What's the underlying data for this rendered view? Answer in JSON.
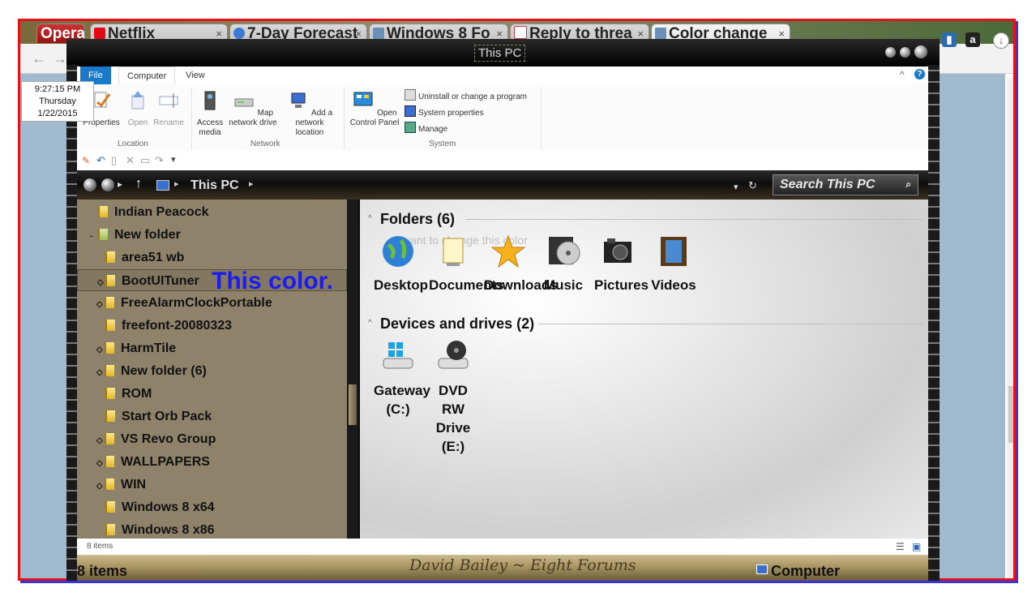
{
  "browser": {
    "tabs": [
      {
        "label": "Opera"
      },
      {
        "label": "Netflix"
      },
      {
        "label": "7-Day Forecast"
      },
      {
        "label": "Windows 8 Fo"
      },
      {
        "label": "Reply to threa"
      },
      {
        "label": "Color change"
      }
    ],
    "close_glyph": "×"
  },
  "clock": {
    "time": "9:27:15 PM",
    "day": "Thursday",
    "date": "1/22/2015"
  },
  "explorer": {
    "title": "This PC",
    "ribbon_tabs": {
      "file": "File",
      "computer": "Computer",
      "view": "View"
    },
    "ribbon": {
      "properties": "Properties",
      "open": "Open",
      "rename": "Rename",
      "access_media": "Access media",
      "map_network_drive": "Map network drive",
      "add_network_location": "Add a network location",
      "open_control_panel": "Open Control Panel",
      "uninstall": "Uninstall or change a program",
      "system_properties": "System properties",
      "manage": "Manage",
      "group_location": "Location",
      "group_network": "Network",
      "group_system": "System"
    },
    "address": {
      "path": "This PC"
    },
    "search_placeholder": "Search This PC",
    "nav_items": [
      {
        "label": "Indian Peacock",
        "expander": ""
      },
      {
        "label": "New folder",
        "expander": "-"
      },
      {
        "label": "area51 wb",
        "expander": ""
      },
      {
        "label": "BootUITuner",
        "expander": "◇"
      },
      {
        "label": "FreeAlarmClockPortable",
        "expander": "◇"
      },
      {
        "label": "freefont-20080323",
        "expander": ""
      },
      {
        "label": "HarmTile",
        "expander": "◇"
      },
      {
        "label": "New folder (6)",
        "expander": "◇"
      },
      {
        "label": "ROM",
        "expander": ""
      },
      {
        "label": "Start Orb Pack",
        "expander": ""
      },
      {
        "label": "VS Revo Group",
        "expander": "◇"
      },
      {
        "label": "WALLPAPERS",
        "expander": "◇"
      },
      {
        "label": "WIN",
        "expander": "◇"
      },
      {
        "label": "Windows 8 x64",
        "expander": ""
      },
      {
        "label": "Windows 8 x86",
        "expander": ""
      }
    ],
    "annotation": "This color.",
    "ghost_text": "want to change this color",
    "folders_title": "Folders (6)",
    "folders": [
      "Desktop",
      "Documents",
      "Downloads",
      "Music",
      "Pictures",
      "Videos"
    ],
    "devices_title": "Devices and drives (2)",
    "devices": [
      "Gateway (C:)",
      "DVD RW Drive (E:)"
    ],
    "status_items": "8 items",
    "bottom_items": "8 items",
    "bottom_signature": "David Bailey ~ Eight Forums",
    "bottom_computer": "Computer"
  },
  "colors": {
    "frame_red": "#e0131b",
    "accent_blue": "#1979ca",
    "annotation_blue": "#1c1cf0"
  }
}
